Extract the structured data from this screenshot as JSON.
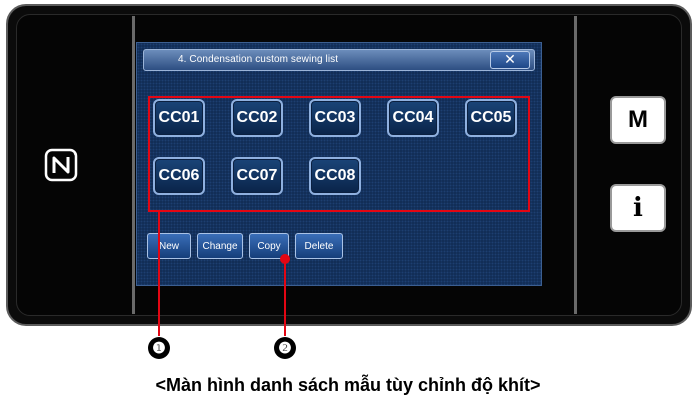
{
  "dialog": {
    "title": "4.   Condensation custom sewing list",
    "close_glyph": "✕"
  },
  "patterns": [
    {
      "label": "CC01"
    },
    {
      "label": "CC02"
    },
    {
      "label": "CC03"
    },
    {
      "label": "CC04"
    },
    {
      "label": "CC05"
    },
    {
      "label": "CC06"
    },
    {
      "label": "CC07"
    },
    {
      "label": "CC08"
    }
  ],
  "actions": {
    "new_label": "New",
    "change_label": "Change",
    "copy_label": "Copy",
    "delete_label": "Delete"
  },
  "side": {
    "mode_label": "M",
    "info_label": "i",
    "nfc_icon": "nfc-icon"
  },
  "annotations": {
    "marker1": "❶",
    "marker2": "❷",
    "caption": "<Màn hình danh sách mẫu tùy chỉnh độ khít>",
    "accent_color": "#e30613"
  }
}
